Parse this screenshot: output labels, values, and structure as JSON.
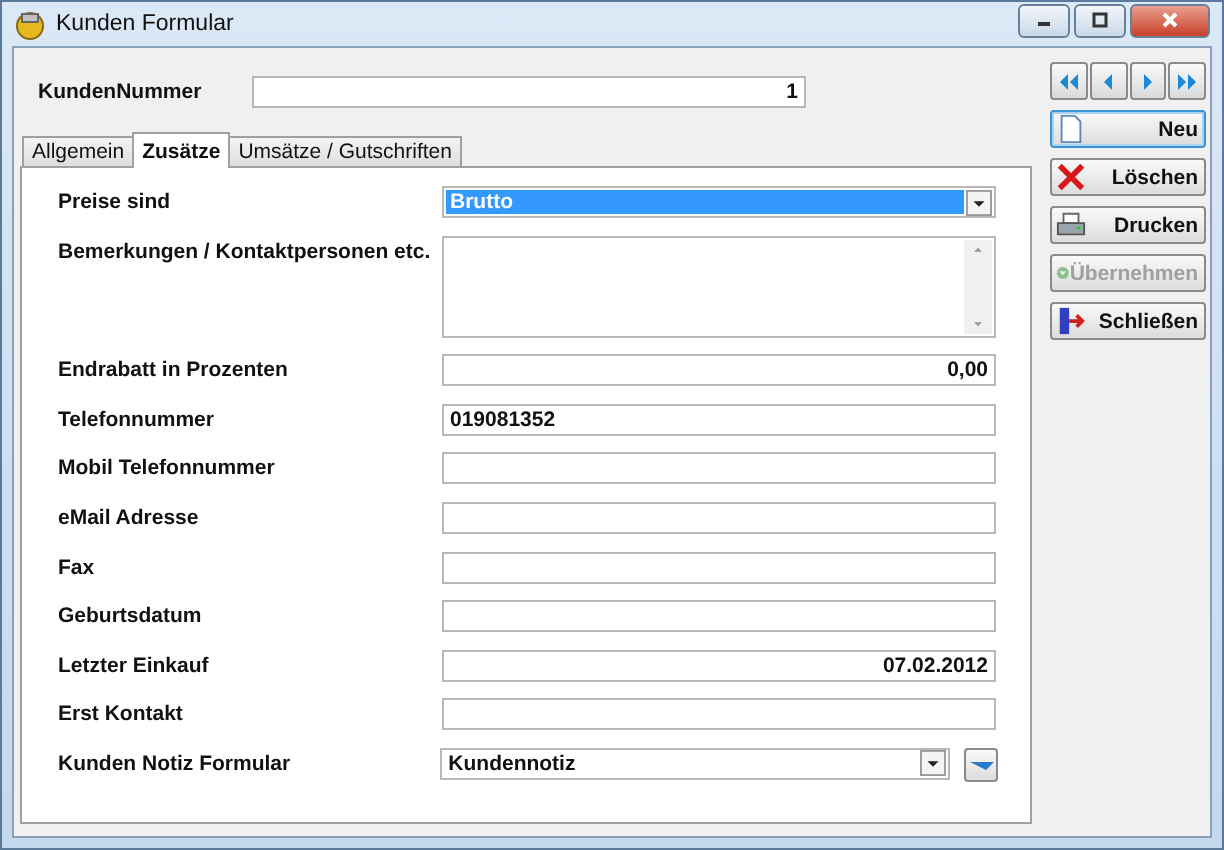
{
  "window": {
    "title": "Kunden Formular"
  },
  "customer_number": {
    "label": "KundenNummer",
    "value": "1"
  },
  "tabs": [
    {
      "label": "Allgemein",
      "selected": false
    },
    {
      "label": "Zusätze",
      "selected": true
    },
    {
      "label": "Umsätze / Gutschriften",
      "selected": false
    }
  ],
  "fields": [
    {
      "label": "Preise sind",
      "kind": "select",
      "value": "Brutto",
      "highlighted": true
    },
    {
      "label": "Bemerkungen / Kontaktpersonen etc.",
      "kind": "textarea"
    },
    {
      "label": "Endrabatt in Prozenten",
      "kind": "number",
      "value": "0,00"
    },
    {
      "label": "Telefonnummer",
      "kind": "text",
      "value": "019081352"
    },
    {
      "label": "Mobil Telefonnummer",
      "kind": "text"
    },
    {
      "label": "eMail Adresse",
      "kind": "text"
    },
    {
      "label": "Fax",
      "kind": "text"
    },
    {
      "label": "Geburtsdatum",
      "kind": "text"
    },
    {
      "label": "Letzter Einkauf",
      "kind": "date",
      "value": "07.02.2012"
    },
    {
      "label": "Erst Kontakt",
      "kind": "text"
    },
    {
      "label": "Kunden Notiz Formular",
      "kind": "select-action",
      "value": "Kundennotiz",
      "highlighted": false
    }
  ],
  "buttons": [
    {
      "label": "Neu",
      "kind": "new",
      "disabled": false,
      "focused": true
    },
    {
      "label": "Löschen",
      "kind": "delete",
      "disabled": false,
      "focused": false
    },
    {
      "label": "Drucken",
      "kind": "print",
      "disabled": false,
      "focused": false
    },
    {
      "label": "Übernehmen",
      "kind": "apply",
      "disabled": true,
      "focused": false
    },
    {
      "label": "Schließen",
      "kind": "close",
      "disabled": false,
      "focused": false
    }
  ]
}
